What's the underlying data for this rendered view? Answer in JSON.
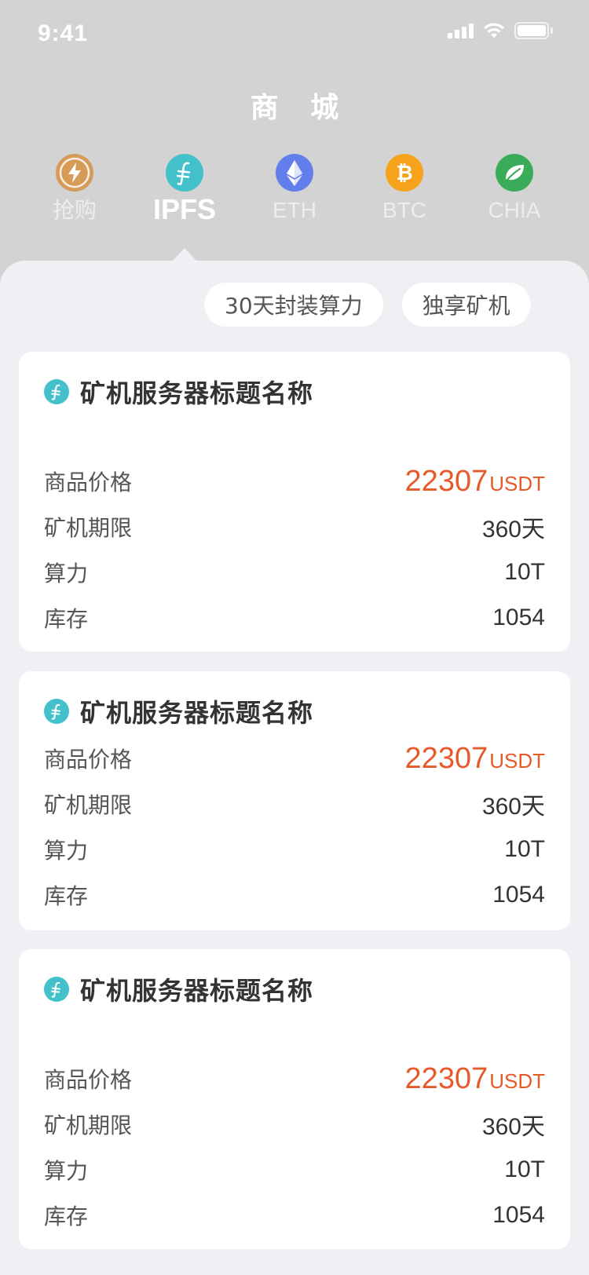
{
  "status_bar": {
    "time": "9:41"
  },
  "header": {
    "title": "商 城"
  },
  "tabs": [
    {
      "label": "抢购",
      "icon": "lightning-icon",
      "color": "#d79b58",
      "active": false
    },
    {
      "label": "IPFS",
      "icon": "filecoin-icon",
      "color": "#42c1ca",
      "active": true
    },
    {
      "label": "ETH",
      "icon": "ethereum-icon",
      "color": "#627eea",
      "active": false
    },
    {
      "label": "BTC",
      "icon": "bitcoin-icon",
      "color": "#f7a21b",
      "active": false
    },
    {
      "label": "CHIA",
      "icon": "leaf-icon",
      "color": "#3aac59",
      "active": false
    }
  ],
  "filters": [
    {
      "label": "30天封装算力"
    },
    {
      "label": "独享矿机"
    }
  ],
  "products": [
    {
      "title": "矿机服务器标题名称",
      "price_label": "商品价格",
      "price": "22307",
      "price_unit": "USDT",
      "term_label": "矿机期限",
      "term": "360天",
      "power_label": "算力",
      "power": "10T",
      "stock_label": "库存",
      "stock": "1054"
    },
    {
      "title": "矿机服务器标题名称",
      "price_label": "商品价格",
      "price": "22307",
      "price_unit": "USDT",
      "term_label": "矿机期限",
      "term": "360天",
      "power_label": "算力",
      "power": "10T",
      "stock_label": "库存",
      "stock": "1054"
    },
    {
      "title": "矿机服务器标题名称",
      "price_label": "商品价格",
      "price": "22307",
      "price_unit": "USDT",
      "term_label": "矿机期限",
      "term": "360天",
      "power_label": "算力",
      "power": "10T",
      "stock_label": "库存",
      "stock": "1054"
    }
  ],
  "colors": {
    "header_bg": "#d3d3d3",
    "page_bg": "#f0f0f4",
    "price": "#e55a28",
    "filecoin": "#42c1ca"
  }
}
